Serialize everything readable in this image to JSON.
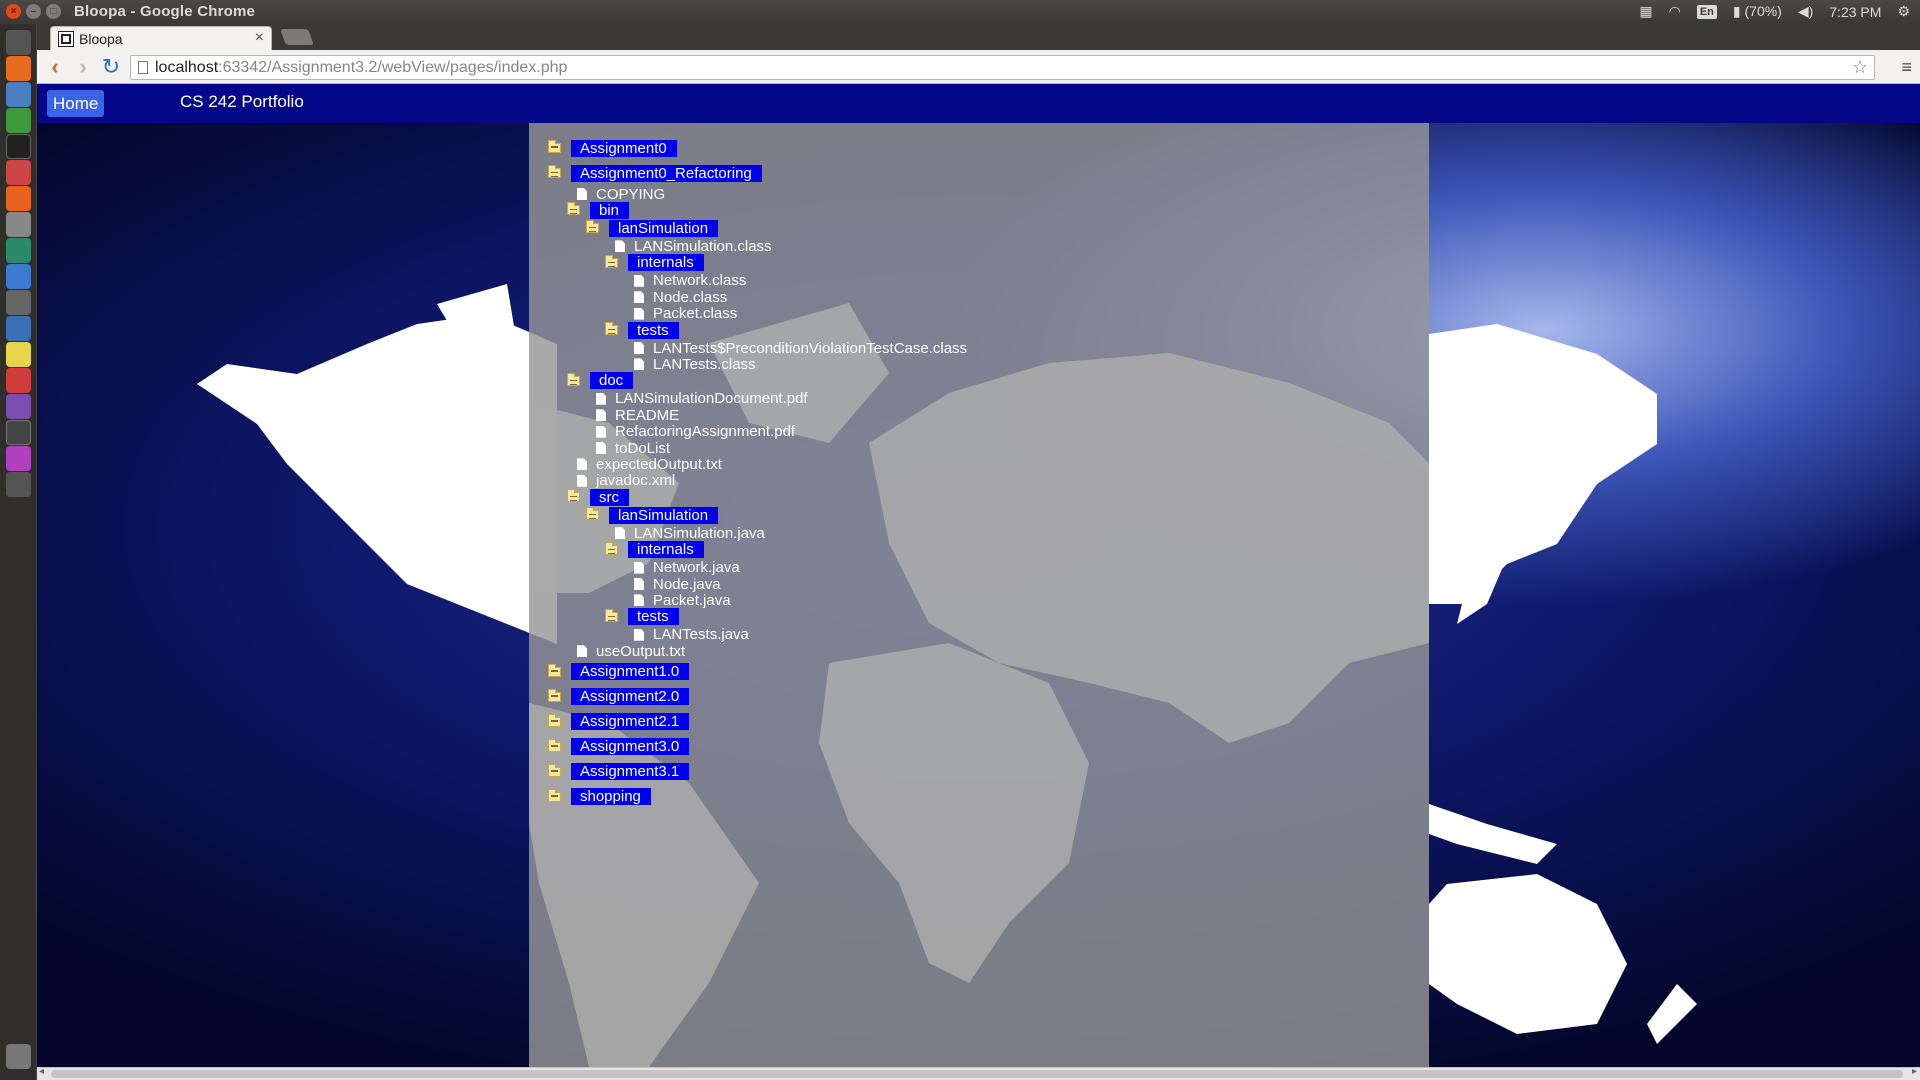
{
  "window": {
    "title": "Bloopa - Google Chrome"
  },
  "system_tray": {
    "keyboard": "En",
    "battery": "(70%)",
    "clock": "7:23 PM"
  },
  "browser": {
    "tab_title": "Bloopa",
    "tab_close": "×",
    "url_host": "localhost",
    "url_rest": ":63342/Assignment3.2/webView/pages/index.php"
  },
  "page": {
    "nav": {
      "home": "Home",
      "portfolio": "CS 242 Portfolio"
    },
    "tree": [
      {
        "type": "folder",
        "state": "closed",
        "depth": 0,
        "label": "Assignment0"
      },
      {
        "type": "folder",
        "state": "open",
        "depth": 0,
        "label": "Assignment0_Refactoring"
      },
      {
        "type": "file",
        "depth": 1,
        "label": "COPYING"
      },
      {
        "type": "folder",
        "state": "open",
        "depth": 1,
        "label": "bin"
      },
      {
        "type": "folder",
        "state": "open",
        "depth": 2,
        "label": "lanSimulation"
      },
      {
        "type": "file",
        "depth": 3,
        "label": "LANSimulation.class"
      },
      {
        "type": "folder",
        "state": "open",
        "depth": 3,
        "label": "internals"
      },
      {
        "type": "file",
        "depth": 4,
        "label": "Network.class"
      },
      {
        "type": "file",
        "depth": 4,
        "label": "Node.class"
      },
      {
        "type": "file",
        "depth": 4,
        "label": "Packet.class"
      },
      {
        "type": "folder",
        "state": "open",
        "depth": 3,
        "label": "tests"
      },
      {
        "type": "file",
        "depth": 4,
        "label": "LANTests$PreconditionViolationTestCase.class"
      },
      {
        "type": "file",
        "depth": 4,
        "label": "LANTests.class"
      },
      {
        "type": "folder",
        "state": "open",
        "depth": 1,
        "label": "doc"
      },
      {
        "type": "file",
        "depth": 2,
        "label": "LANSimulationDocument.pdf"
      },
      {
        "type": "file",
        "depth": 2,
        "label": "README"
      },
      {
        "type": "file",
        "depth": 2,
        "label": "RefactoringAssignment.pdf"
      },
      {
        "type": "file",
        "depth": 2,
        "label": "toDoList"
      },
      {
        "type": "file",
        "depth": 1,
        "label": "expectedOutput.txt"
      },
      {
        "type": "file",
        "depth": 1,
        "label": "javadoc.xml"
      },
      {
        "type": "folder",
        "state": "open",
        "depth": 1,
        "label": "src"
      },
      {
        "type": "folder",
        "state": "open",
        "depth": 2,
        "label": "lanSimulation"
      },
      {
        "type": "file",
        "depth": 3,
        "label": "LANSimulation.java"
      },
      {
        "type": "folder",
        "state": "open",
        "depth": 3,
        "label": "internals"
      },
      {
        "type": "file",
        "depth": 4,
        "label": "Network.java"
      },
      {
        "type": "file",
        "depth": 4,
        "label": "Node.java"
      },
      {
        "type": "file",
        "depth": 4,
        "label": "Packet.java"
      },
      {
        "type": "folder",
        "state": "open",
        "depth": 3,
        "label": "tests"
      },
      {
        "type": "file",
        "depth": 4,
        "label": "LANTests.java"
      },
      {
        "type": "file",
        "depth": 1,
        "label": "useOutput.txt"
      },
      {
        "type": "folder",
        "state": "closed",
        "depth": 0,
        "label": "Assignment1.0"
      },
      {
        "type": "folder",
        "state": "closed",
        "depth": 0,
        "label": "Assignment2.0"
      },
      {
        "type": "folder",
        "state": "closed",
        "depth": 0,
        "label": "Assignment2.1"
      },
      {
        "type": "folder",
        "state": "closed",
        "depth": 0,
        "label": "Assignment3.0"
      },
      {
        "type": "folder",
        "state": "closed",
        "depth": 0,
        "label": "Assignment3.1"
      },
      {
        "type": "folder",
        "state": "closed",
        "depth": 0,
        "label": "shopping"
      }
    ]
  },
  "colors": {
    "navbar": "#040888",
    "home_button": "#3b63e8",
    "folder_label": "#0000ee"
  }
}
